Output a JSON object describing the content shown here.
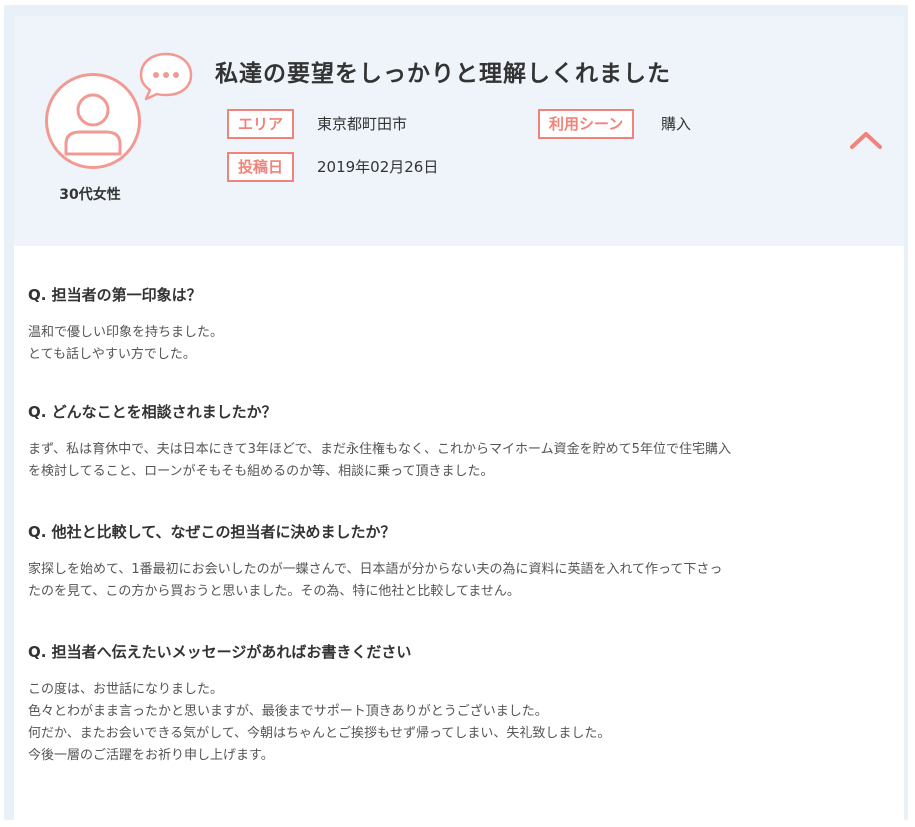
{
  "review": {
    "title": "私達の要望をしっかりと理解しくれました",
    "reviewer": "30代女性",
    "area_label": "エリア",
    "area_value": "東京都町田市",
    "scene_label": "利用シーン",
    "scene_value": "購入",
    "date_label": "投稿日",
    "date_value": "2019年02月26日"
  },
  "qa": [
    {
      "question": "Q. 担当者の第一印象は？",
      "answer_lines": [
        "温和で優しい印象を持ちました。",
        "とても話しやすい方でした。"
      ]
    },
    {
      "question": "Q. どんなことを相談されましたか？",
      "answer_lines": [
        "まず、私は育休中で、夫は日本にきて3年ほどで、まだ永住権もなく、これからマイホーム資金を貯めて5年位で住宅購入",
        "を検討してること、ローンがそもそも組めるのか等、相談に乗って頂きました。"
      ]
    },
    {
      "question": "Q. 他社と比較して、なぜこの担当者に決めましたか？",
      "answer_lines": [
        "家探しを始めて、1番最初にお会いしたのが一蝶さんで、日本語が分からない夫の為に資料に英語を入れて作って下さっ",
        "たのを見て、この方から買おうと思いました。その為、特に他社と比較してません。"
      ]
    },
    {
      "question": "Q. 担当者へ伝えたいメッセージがあればお書きください",
      "answer_lines": [
        "この度は、お世話になりました。",
        "色々とわがまま言ったかと思いますが、最後までサポート頂きありがとうございました。",
        "何だか、またお会いできる気がして、今朝はちゃんとご挨拶もせず帰ってしまい、失礼致しました。",
        "今後一層のご活躍をお祈り申し上げます。"
      ]
    }
  ],
  "colors": {
    "accent": "#f0837a",
    "header_bg": "#eef4fa",
    "frame_bg": "#e8f1f8"
  },
  "icons": {
    "avatar": "user-avatar-icon",
    "bubble": "speech-bubble-icon",
    "toggle": "chevron-up-icon"
  }
}
